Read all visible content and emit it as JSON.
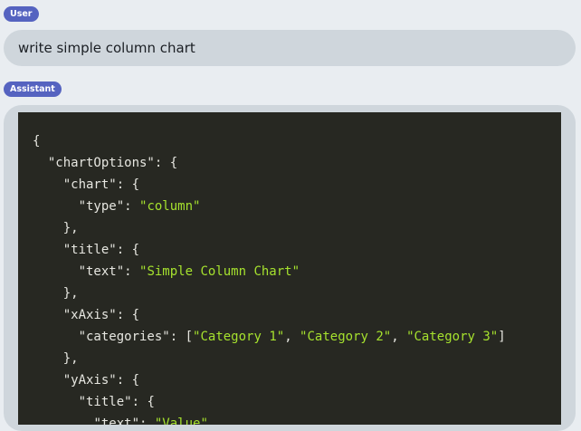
{
  "conversation": {
    "user": {
      "role_label": "User",
      "message": "write simple column chart"
    },
    "assistant": {
      "role_label": "Assistant",
      "code_lines": [
        [
          {
            "t": "p",
            "v": "{"
          }
        ],
        [
          {
            "t": "p",
            "v": "  "
          },
          {
            "t": "k",
            "v": "\"chartOptions\""
          },
          {
            "t": "p",
            "v": ": {"
          }
        ],
        [
          {
            "t": "p",
            "v": "    "
          },
          {
            "t": "k",
            "v": "\"chart\""
          },
          {
            "t": "p",
            "v": ": {"
          }
        ],
        [
          {
            "t": "p",
            "v": "      "
          },
          {
            "t": "k",
            "v": "\"type\""
          },
          {
            "t": "p",
            "v": ": "
          },
          {
            "t": "s",
            "v": "\"column\""
          }
        ],
        [
          {
            "t": "p",
            "v": "    },"
          }
        ],
        [
          {
            "t": "p",
            "v": "    "
          },
          {
            "t": "k",
            "v": "\"title\""
          },
          {
            "t": "p",
            "v": ": {"
          }
        ],
        [
          {
            "t": "p",
            "v": "      "
          },
          {
            "t": "k",
            "v": "\"text\""
          },
          {
            "t": "p",
            "v": ": "
          },
          {
            "t": "s",
            "v": "\"Simple Column Chart\""
          }
        ],
        [
          {
            "t": "p",
            "v": "    },"
          }
        ],
        [
          {
            "t": "p",
            "v": "    "
          },
          {
            "t": "k",
            "v": "\"xAxis\""
          },
          {
            "t": "p",
            "v": ": {"
          }
        ],
        [
          {
            "t": "p",
            "v": "      "
          },
          {
            "t": "k",
            "v": "\"categories\""
          },
          {
            "t": "p",
            "v": ": ["
          },
          {
            "t": "s",
            "v": "\"Category 1\""
          },
          {
            "t": "p",
            "v": ", "
          },
          {
            "t": "s",
            "v": "\"Category 2\""
          },
          {
            "t": "p",
            "v": ", "
          },
          {
            "t": "s",
            "v": "\"Category 3\""
          },
          {
            "t": "p",
            "v": "]"
          }
        ],
        [
          {
            "t": "p",
            "v": "    },"
          }
        ],
        [
          {
            "t": "p",
            "v": "    "
          },
          {
            "t": "k",
            "v": "\"yAxis\""
          },
          {
            "t": "p",
            "v": ": {"
          }
        ],
        [
          {
            "t": "p",
            "v": "      "
          },
          {
            "t": "k",
            "v": "\"title\""
          },
          {
            "t": "p",
            "v": ": {"
          }
        ],
        [
          {
            "t": "p",
            "v": "        "
          },
          {
            "t": "k",
            "v": "\"text\""
          },
          {
            "t": "p",
            "v": ": "
          },
          {
            "t": "s",
            "v": "\"Value\""
          }
        ]
      ]
    }
  },
  "colors": {
    "background": "#e9edf1",
    "bubble": "#cfd6dc",
    "badge": "#5563c0",
    "code_background": "#272822",
    "code_text": "#e6e6e0",
    "code_string": "#a6e22e"
  }
}
